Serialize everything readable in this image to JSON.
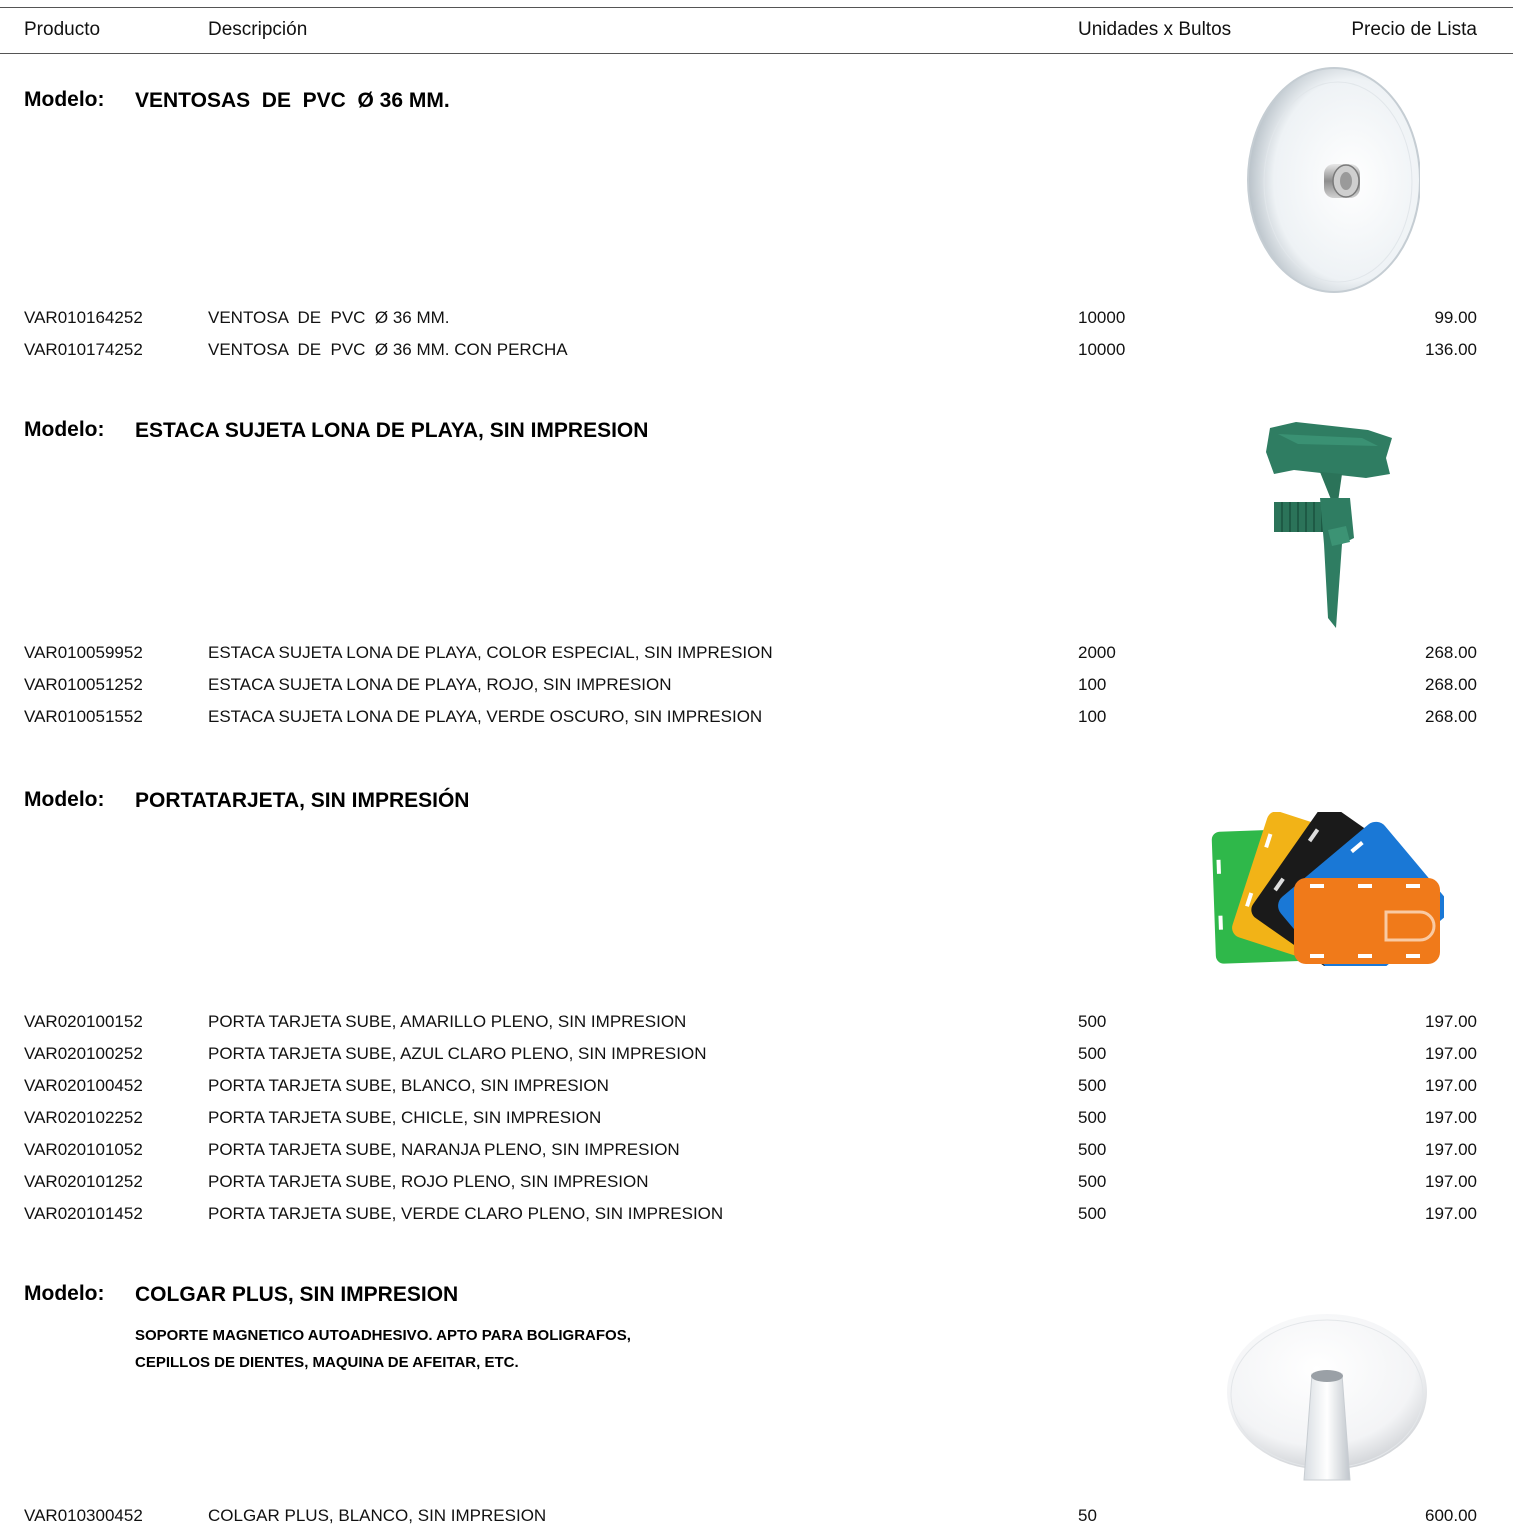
{
  "header": {
    "producto": "Producto",
    "descripcion": "Descripción",
    "unidades": "Unidades x Bultos",
    "precio": "Precio de Lista"
  },
  "model_label": "Modelo:",
  "sections": [
    {
      "name": "VENTOSAS  DE  PVC  Ø 36 MM.",
      "image_icon": "suction-cup-icon",
      "rows": [
        {
          "code": "VAR010164252",
          "desc": "VENTOSA  DE  PVC  Ø 36 MM.",
          "units": "10000",
          "price": "99.00"
        },
        {
          "code": "VAR010174252",
          "desc": "VENTOSA  DE  PVC  Ø 36 MM. CON PERCHA",
          "units": "10000",
          "price": "136.00"
        }
      ]
    },
    {
      "name": "ESTACA SUJETA LONA DE PLAYA, SIN IMPRESION",
      "image_icon": "beach-stake-icon",
      "rows": [
        {
          "code": "VAR010059952",
          "desc": "ESTACA SUJETA LONA DE PLAYA, COLOR ESPECIAL, SIN IMPRESION",
          "units": "2000",
          "price": "268.00"
        },
        {
          "code": "VAR010051252",
          "desc": "ESTACA SUJETA LONA DE PLAYA, ROJO, SIN IMPRESION",
          "units": "100",
          "price": "268.00"
        },
        {
          "code": "VAR010051552",
          "desc": "ESTACA SUJETA LONA DE PLAYA, VERDE OSCURO, SIN IMPRESION",
          "units": "100",
          "price": "268.00"
        }
      ]
    },
    {
      "name": "PORTATARJETA, SIN IMPRESIÓN",
      "image_icon": "card-holders-icon",
      "rows": [
        {
          "code": "VAR020100152",
          "desc": "PORTA TARJETA SUBE, AMARILLO PLENO, SIN IMPRESION",
          "units": "500",
          "price": "197.00"
        },
        {
          "code": "VAR020100252",
          "desc": "PORTA TARJETA SUBE, AZUL CLARO PLENO, SIN IMPRESION",
          "units": "500",
          "price": "197.00"
        },
        {
          "code": "VAR020100452",
          "desc": "PORTA TARJETA SUBE, BLANCO, SIN IMPRESION",
          "units": "500",
          "price": "197.00"
        },
        {
          "code": "VAR020102252",
          "desc": "PORTA TARJETA SUBE, CHICLE, SIN IMPRESION",
          "units": "500",
          "price": "197.00"
        },
        {
          "code": "VAR020101052",
          "desc": "PORTA TARJETA SUBE, NARANJA PLENO, SIN IMPRESION",
          "units": "500",
          "price": "197.00"
        },
        {
          "code": "VAR020101252",
          "desc": "PORTA TARJETA SUBE, ROJO PLENO, SIN IMPRESION",
          "units": "500",
          "price": "197.00"
        },
        {
          "code": "VAR020101452",
          "desc": "PORTA TARJETA SUBE, VERDE CLARO PLENO, SIN IMPRESION",
          "units": "500",
          "price": "197.00"
        }
      ]
    },
    {
      "name": "COLGAR PLUS, SIN IMPRESION",
      "description": [
        "SOPORTE MAGNETICO AUTOADHESIVO. APTO PARA BOLIGRAFOS,",
        "CEPILLOS DE DIENTES, MAQUINA DE AFEITAR, ETC."
      ],
      "image_icon": "magnetic-holder-icon",
      "rows": [
        {
          "code": "VAR010300452",
          "desc": "COLGAR PLUS, BLANCO, SIN IMPRESION",
          "units": "50",
          "price": "600.00"
        }
      ]
    }
  ],
  "colors": {
    "text": "#000000",
    "rule": "#555555",
    "stake_green": "#2f7d62",
    "card_green": "#2fb84a",
    "card_yellow": "#f2b317",
    "card_black": "#1a1a1a",
    "card_blue": "#1a78d6",
    "card_orange": "#f07a1a"
  }
}
